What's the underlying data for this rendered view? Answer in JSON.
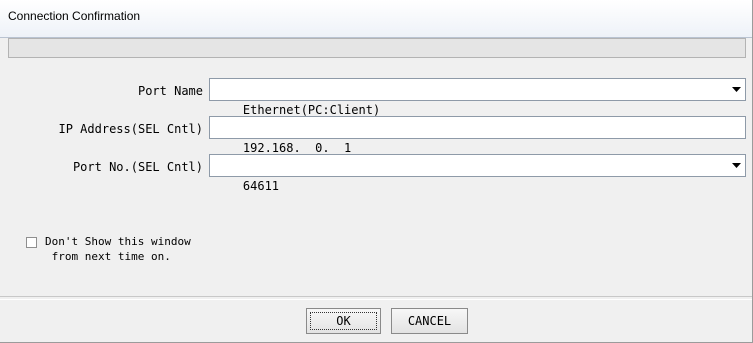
{
  "window": {
    "title": "Connection Confirmation"
  },
  "form": {
    "port_name_label": "Port Name",
    "port_name_value": "Ethernet(PC:Client)",
    "ip_label": "IP Address(SEL Cntl)",
    "ip_value": "192.168.  0.  1",
    "port_no_label": "Port No.(SEL Cntl)",
    "port_no_value": "64611"
  },
  "options": {
    "dont_show_label": "Don't Show this window\n from next time on.",
    "dont_show_checked": false
  },
  "buttons": {
    "ok_label": "OK",
    "cancel_label": "CANCEL"
  }
}
